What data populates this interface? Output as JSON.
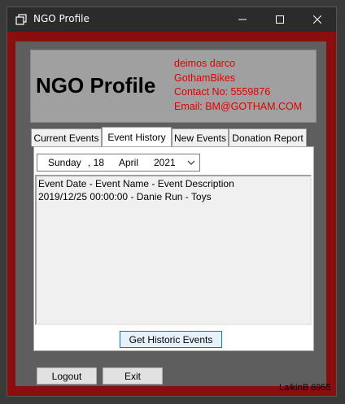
{
  "window": {
    "title": "NGO Profile",
    "controls": {
      "minimize": "minimize-icon",
      "maximize": "maximize-icon",
      "close": "close-icon"
    }
  },
  "header": {
    "title": "NGO Profile",
    "name": "deimos darco",
    "organization": "GothamBikes",
    "contact": "Contact No: 5559876",
    "email": "Email: BM@GOTHAM.COM"
  },
  "tabs": [
    {
      "label": "Current Events",
      "active": false
    },
    {
      "label": "Event History",
      "active": true
    },
    {
      "label": "New Events",
      "active": false
    },
    {
      "label": "Donation Report",
      "active": false
    }
  ],
  "date_picker": {
    "day": "Sunday",
    "date": ", 18",
    "month": "April",
    "year": "2021"
  },
  "event_list": [
    "Event Date - Event Name - Event Description",
    "2019/12/25 00:00:00 - Danie Run - Toys"
  ],
  "buttons": {
    "get_historic": "Get Historic Events",
    "logout": "Logout",
    "exit": "Exit"
  },
  "footer": {
    "credit": "LaikinB 6955"
  },
  "colors": {
    "frame": "#8b0e0e",
    "info_text": "#e00000",
    "titlebar": "#2b2b2b"
  }
}
